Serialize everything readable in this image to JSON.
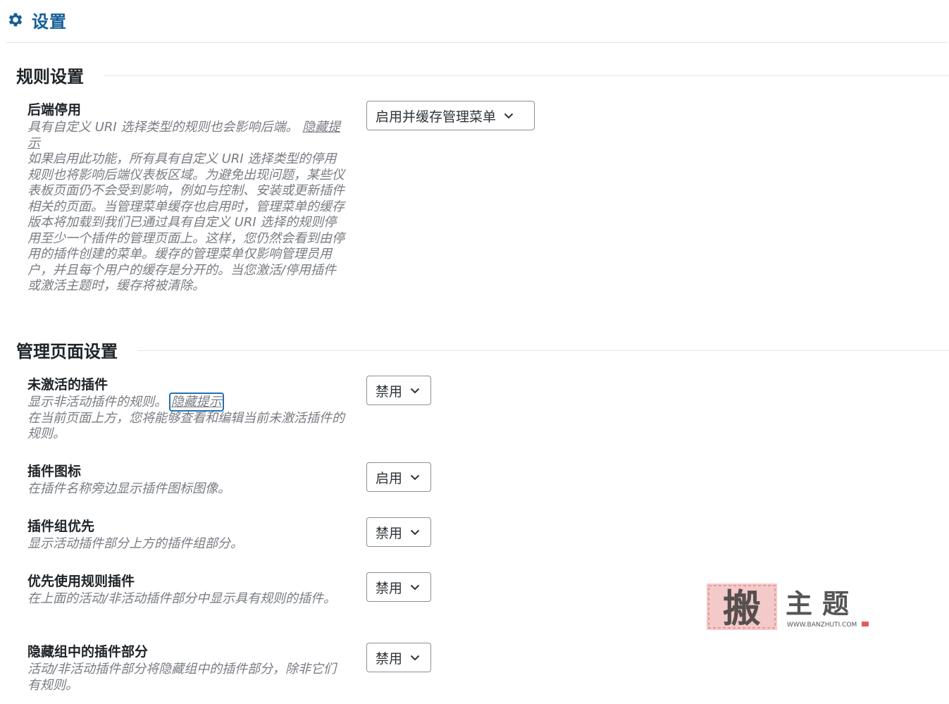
{
  "header": {
    "title": "设置",
    "icon": "gear-icon",
    "accent": "#135e96"
  },
  "sections": [
    {
      "title": "规则设置",
      "rows": [
        {
          "label": "后端停用",
          "desc_lead": "具有自定义 URI 选择类型的规则也会影响后端。",
          "hint_link": "隐藏提示",
          "desc_body": "如果启用此功能，所有具有自定义 URI 选择类型的停用规则也将影响后端仪表板区域。为避免出现问题，某些仪表板页面仍不会受到影响，例如与控制、安装或更新插件相关的页面。当管理菜单缓存也启用时，管理菜单的缓存版本将加载到我们已通过具有自定义 URI 选择的规则停用至少一个插件的管理页面上。这样，您仍然会看到由停用的插件创建的菜单。缓存的管理菜单仅影响管理员用户，并且每个用户的缓存是分开的。当您激活/停用插件或激活主题时，缓存将被清除。",
          "select_value": "启用并缓存管理菜单"
        }
      ]
    },
    {
      "title": "管理页面设置",
      "rows": [
        {
          "label": "未激活的插件",
          "desc_lead": "显示非活动插件的规则。",
          "hint_link": "隐藏提示",
          "desc_body": "在当前页面上方，您将能够查看和编辑当前未激活插件的规则。",
          "select_value": "禁用"
        },
        {
          "label": "插件图标",
          "desc": "在插件名称旁边显示插件图标图像。",
          "select_value": "启用"
        },
        {
          "label": "插件组优先",
          "desc": "显示活动插件部分上方的插件组部分。",
          "select_value": "禁用"
        },
        {
          "label": "优先使用规则插件",
          "desc": "在上面的活动/非活动插件部分中显示具有规则的插件。",
          "select_value": "禁用"
        },
        {
          "label": "隐藏组中的插件部分",
          "desc": "活动/非活动插件部分将隐藏组中的插件部分，除非它们有规则。",
          "select_value": "禁用"
        }
      ]
    }
  ],
  "watermark": {
    "brand": "搬主题",
    "url": "WWW.BANZHUTI.COM"
  }
}
